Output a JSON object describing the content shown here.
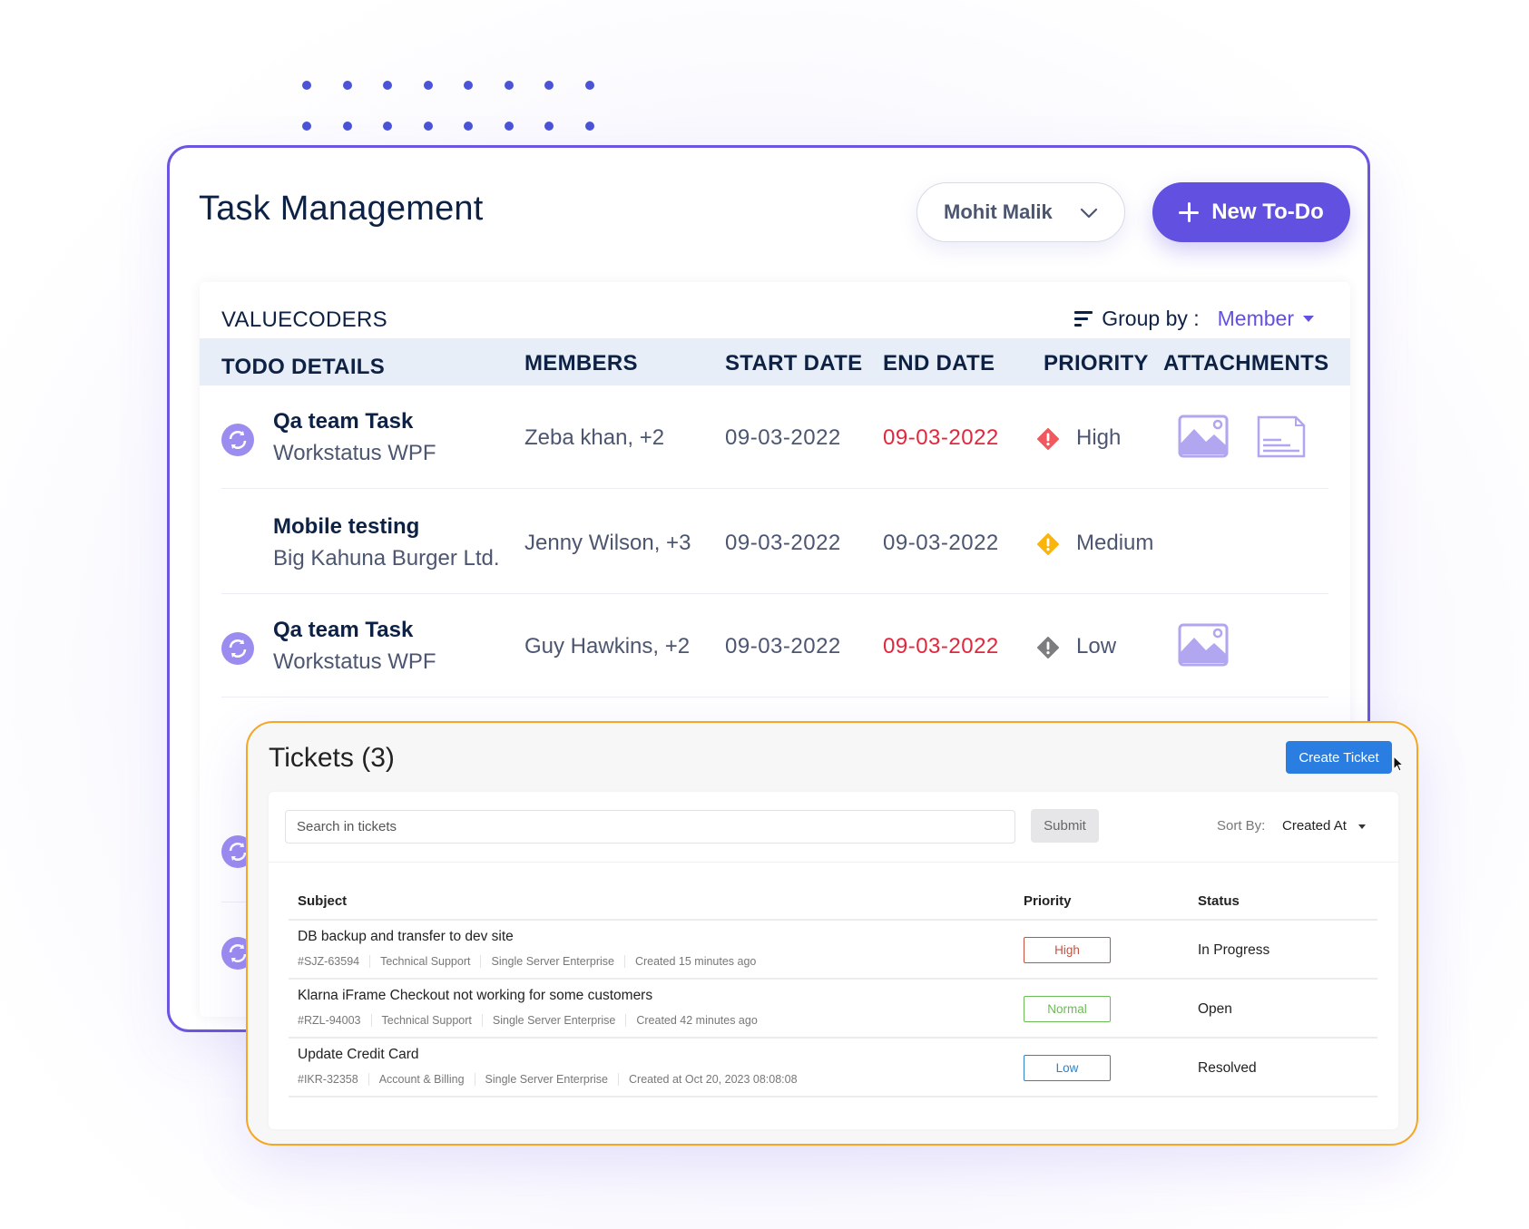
{
  "task_panel": {
    "title": "Task Management",
    "user_select": {
      "value": "Mohit Malik"
    },
    "new_todo_label": "New To-Do",
    "org_name": "VALUECODERS",
    "group_by": {
      "label": "Group by :",
      "value": "Member"
    },
    "columns": [
      "TODO DETAILS",
      "MEMBERS",
      "START DATE",
      "END DATE",
      "PRIORITY",
      "ATTACHMENTS"
    ],
    "rows": [
      {
        "name": "Qa team Task",
        "project": "Workstatus WPF",
        "members": "Zeba khan, +2",
        "start": "09-03-2022",
        "end": "09-03-2022",
        "end_overdue": true,
        "priority": "High",
        "recurring": true,
        "attachments": [
          "image-icon",
          "document-icon"
        ]
      },
      {
        "name": "Mobile testing",
        "project": "Big Kahuna Burger Ltd.",
        "members": "Jenny Wilson, +3",
        "start": "09-03-2022",
        "end": "09-03-2022",
        "end_overdue": false,
        "priority": "Medium",
        "recurring": false,
        "attachments": []
      },
      {
        "name": "Qa team Task",
        "project": "Workstatus WPF",
        "members": "Guy Hawkins, +2",
        "start": "09-03-2022",
        "end": "09-03-2022",
        "end_overdue": true,
        "priority": "Low",
        "recurring": true,
        "attachments": [
          "image-icon"
        ]
      }
    ],
    "colors": {
      "accent": "#6250e0",
      "border": "#6c55e0",
      "overdue": "#e0283d",
      "high": "#f0585e",
      "medium": "#fbb40b",
      "low": "#7d7d80",
      "attachment": "#b1a6f0"
    }
  },
  "tickets_panel": {
    "title": "Tickets (3)",
    "create_label": "Create Ticket",
    "search_placeholder": "Search in tickets",
    "submit_label": "Submit",
    "sort_label": "Sort By:",
    "sort_value": "Created At",
    "columns": {
      "subject": "Subject",
      "priority": "Priority",
      "status": "Status"
    },
    "rows": [
      {
        "subject": "DB backup and transfer to dev site",
        "id": "#SJZ-63594",
        "category": "Technical Support",
        "plan": "Single Server Enterprise",
        "created": "Created 15 minutes ago",
        "priority": "High",
        "status": "In Progress"
      },
      {
        "subject": "Klarna iFrame Checkout not working for some customers",
        "id": "#RZL-94003",
        "category": "Technical Support",
        "plan": "Single Server Enterprise",
        "created": "Created 42 minutes ago",
        "priority": "Normal",
        "status": "Open"
      },
      {
        "subject": "Update Credit Card",
        "id": "#IKR-32358",
        "category": "Account & Billing",
        "plan": "Single Server Enterprise",
        "created": "Created at Oct 20, 2023 08:08:08",
        "priority": "Low",
        "status": "Resolved"
      }
    ],
    "colors": {
      "border": "#f5a623",
      "create_button": "#2a7de1",
      "high": "#c9503f",
      "normal": "#6dbb57",
      "low": "#2f82c9"
    }
  }
}
